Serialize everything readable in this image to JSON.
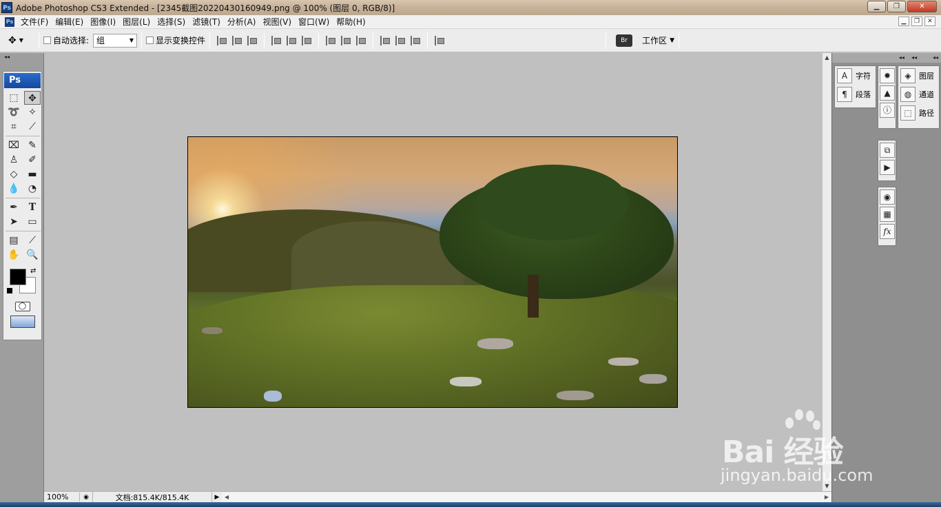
{
  "window": {
    "title": "Adobe Photoshop CS3 Extended - [2345截图20220430160949.png @ 100% (图层 0, RGB/8)]",
    "app_icon": "Ps"
  },
  "menu": {
    "items": [
      "文件(F)",
      "编辑(E)",
      "图像(I)",
      "图层(L)",
      "选择(S)",
      "滤镜(T)",
      "分析(A)",
      "视图(V)",
      "窗口(W)",
      "帮助(H)"
    ]
  },
  "options": {
    "auto_select_label": "自动选择:",
    "auto_select_value": "组",
    "show_transform_label": "显示变换控件",
    "workspace_label": "工作区"
  },
  "toolbox": {
    "logo": "Ps"
  },
  "panels": {
    "group1": [
      "字符",
      "段落"
    ],
    "group3": [
      "图层",
      "通道",
      "路径"
    ]
  },
  "status": {
    "zoom": "100%",
    "doc_info": "文档:815.4K/815.4K"
  },
  "watermark": {
    "brand": "Bai  经验",
    "url": "jingyan.baidu.com"
  },
  "colors": {
    "foreground": "#000000",
    "background": "#ffffff",
    "workspace_bg": "#c0c0c0"
  }
}
